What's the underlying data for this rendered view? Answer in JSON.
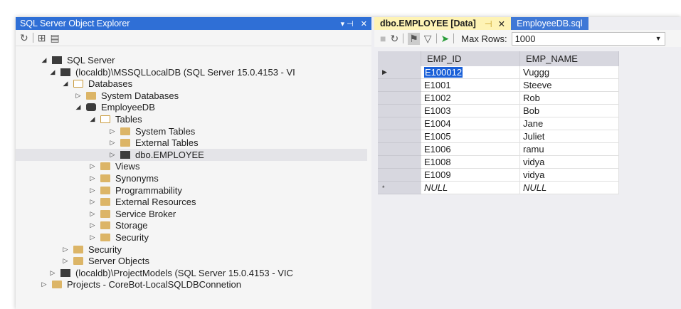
{
  "object_explorer": {
    "title": "SQL Server Object Explorer",
    "pin_glyph": "▾ ⊣",
    "close_glyph": "✕",
    "tree": [
      {
        "label": "SQL Server",
        "level": 0,
        "expanded": true,
        "icon": "sql-server-icon"
      },
      {
        "label": "(localdb)\\MSSQLLocalDB (SQL Server 15.0.4153 - VI",
        "level": 1,
        "expanded": true,
        "icon": "server-icon"
      },
      {
        "label": "Databases",
        "level": 2,
        "expanded": true,
        "icon": "folder-open-icon"
      },
      {
        "label": "System Databases",
        "level": 3,
        "expanded": false,
        "icon": "folder-icon"
      },
      {
        "label": "EmployeeDB",
        "level": 3,
        "expanded": true,
        "icon": "database-icon"
      },
      {
        "label": "Tables",
        "level": 4,
        "expanded": true,
        "icon": "folder-open-icon"
      },
      {
        "label": "System Tables",
        "level": 5,
        "expanded": false,
        "icon": "folder-icon"
      },
      {
        "label": "External Tables",
        "level": 5,
        "expanded": false,
        "icon": "folder-icon"
      },
      {
        "label": "dbo.EMPLOYEE",
        "level": 5,
        "expanded": false,
        "icon": "table-icon",
        "selected": true
      },
      {
        "label": "Views",
        "level": 4,
        "expanded": false,
        "icon": "folder-icon"
      },
      {
        "label": "Synonyms",
        "level": 4,
        "expanded": false,
        "icon": "folder-icon"
      },
      {
        "label": "Programmability",
        "level": 4,
        "expanded": false,
        "icon": "folder-icon"
      },
      {
        "label": "External Resources",
        "level": 4,
        "expanded": false,
        "icon": "folder-icon"
      },
      {
        "label": "Service Broker",
        "level": 4,
        "expanded": false,
        "icon": "folder-icon"
      },
      {
        "label": "Storage",
        "level": 4,
        "expanded": false,
        "icon": "folder-icon"
      },
      {
        "label": "Security",
        "level": 4,
        "expanded": false,
        "icon": "folder-icon"
      },
      {
        "label": "Security",
        "level": 2,
        "expanded": false,
        "icon": "folder-icon"
      },
      {
        "label": "Server Objects",
        "level": 2,
        "expanded": false,
        "icon": "folder-icon"
      },
      {
        "label": "(localdb)\\ProjectModels (SQL Server 15.0.4153 - VIC",
        "level": 1,
        "expanded": false,
        "icon": "server-icon"
      },
      {
        "label": "Projects - CoreBot-LocalSQLDBConnetion",
        "level": 0,
        "expanded": false,
        "icon": "folder-icon"
      }
    ]
  },
  "editor": {
    "active_tab": "dbo.EMPLOYEE [Data]",
    "inactive_tab": "EmployeeDB.sql",
    "max_rows_label": "Max Rows:",
    "max_rows_value": "1000",
    "columns": [
      "EMP_ID",
      "EMP_NAME"
    ],
    "rows": [
      {
        "marker": "▶",
        "id": "E100012",
        "name": "Vuggg"
      },
      {
        "marker": "",
        "id": "E1001",
        "name": "Steeve"
      },
      {
        "marker": "",
        "id": "E1002",
        "name": "Rob"
      },
      {
        "marker": "",
        "id": "E1003",
        "name": "Bob"
      },
      {
        "marker": "",
        "id": "E1004",
        "name": "Jane"
      },
      {
        "marker": "",
        "id": "E1005",
        "name": "Juliet"
      },
      {
        "marker": "",
        "id": "E1006",
        "name": "ramu"
      },
      {
        "marker": "",
        "id": "E1008",
        "name": "vidya"
      },
      {
        "marker": "",
        "id": "E1009",
        "name": "vidya"
      },
      {
        "marker": "*",
        "id": "NULL",
        "name": "NULL"
      }
    ]
  }
}
